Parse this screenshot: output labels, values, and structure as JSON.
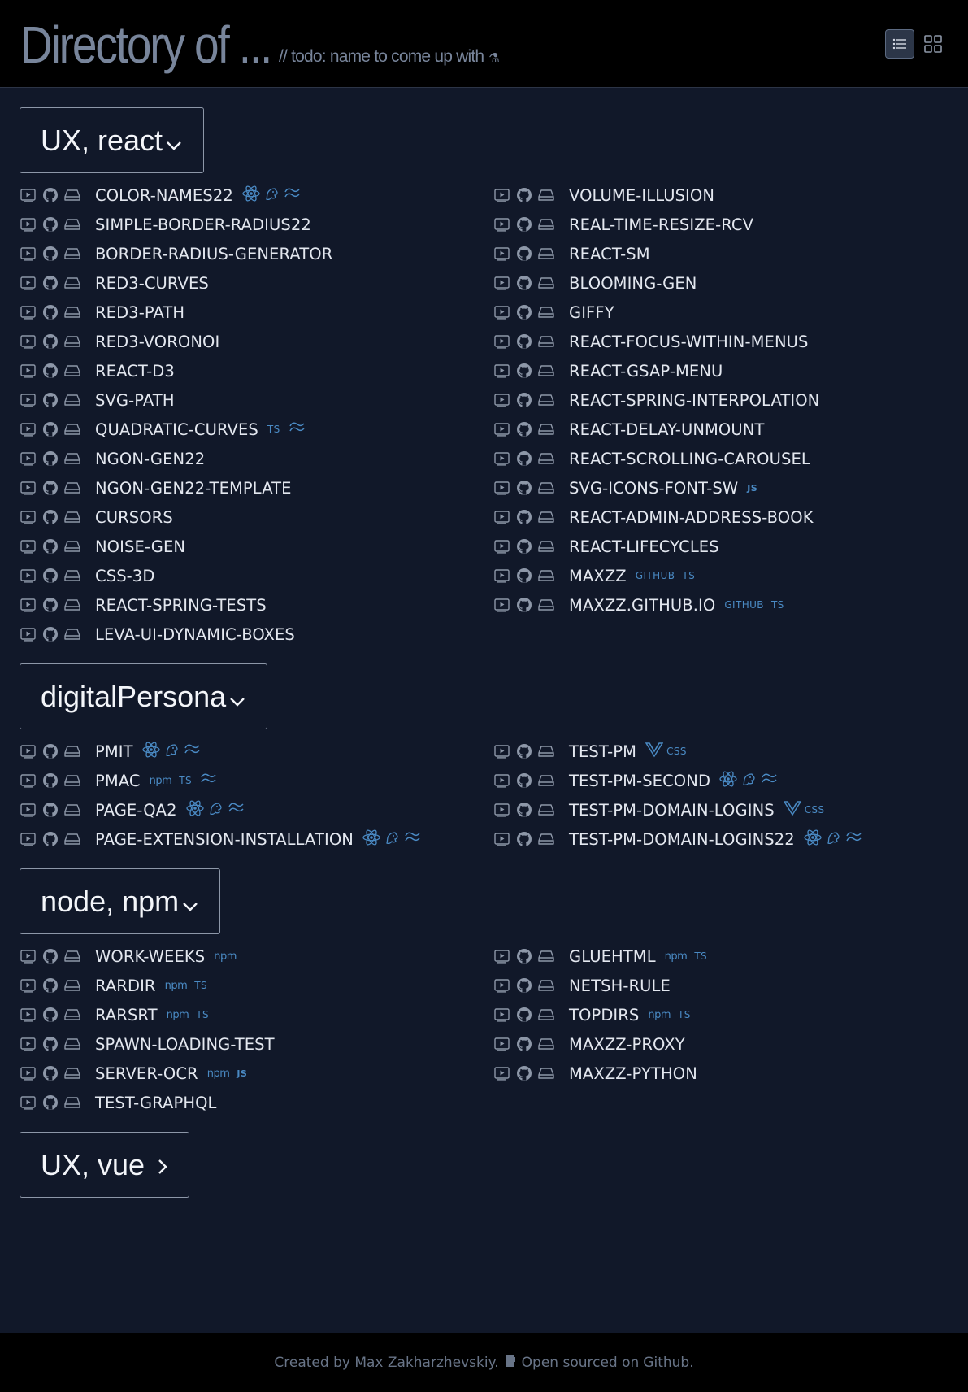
{
  "header": {
    "title": "Directory of ...",
    "subtitle": "// todo: name to come up with",
    "view_buttons": [
      "list-view",
      "grid-view"
    ]
  },
  "colors": {
    "background": "#111829",
    "header_bg": "#000000",
    "accent": "#4a8ac4",
    "title": "#78859b"
  },
  "groups": [
    {
      "title": "UX, react",
      "expanded": true,
      "items": [
        {
          "name": "COLOR-NAMES22",
          "tags": [
            "react",
            "js",
            "tw"
          ]
        },
        {
          "name": "VOLUME-ILLUSION",
          "tags": []
        },
        {
          "name": "SIMPLE-BORDER-RADIUS22",
          "tags": []
        },
        {
          "name": "REAL-TIME-RESIZE-RCV",
          "tags": []
        },
        {
          "name": "BORDER-RADIUS-GENERATOR",
          "tags": []
        },
        {
          "name": "REACT-SM",
          "tags": []
        },
        {
          "name": "RED3-CURVES",
          "tags": []
        },
        {
          "name": "BLOOMING-GEN",
          "tags": []
        },
        {
          "name": "RED3-PATH",
          "tags": []
        },
        {
          "name": "GIFFY",
          "tags": []
        },
        {
          "name": "RED3-VORONOI",
          "tags": []
        },
        {
          "name": "REACT-FOCUS-WITHIN-MENUS",
          "tags": []
        },
        {
          "name": "REACT-D3",
          "tags": []
        },
        {
          "name": "REACT-GSAP-MENU",
          "tags": []
        },
        {
          "name": "SVG-PATH",
          "tags": []
        },
        {
          "name": "REACT-SPRING-INTERPOLATION",
          "tags": []
        },
        {
          "name": "QUADRATIC-CURVES",
          "tags": [
            "TS",
            "tw"
          ]
        },
        {
          "name": "REACT-DELAY-UNMOUNT",
          "tags": []
        },
        {
          "name": "NGON-GEN22",
          "tags": []
        },
        {
          "name": "REACT-SCROLLING-CAROUSEL",
          "tags": []
        },
        {
          "name": "NGON-GEN22-TEMPLATE",
          "tags": []
        },
        {
          "name": "SVG-ICONS-FONT-SW",
          "tags": [
            "JS"
          ]
        },
        {
          "name": "CURSORS",
          "tags": []
        },
        {
          "name": "REACT-ADMIN-ADDRESS-BOOK",
          "tags": []
        },
        {
          "name": "NOISE-GEN",
          "tags": []
        },
        {
          "name": "REACT-LIFECYCLES",
          "tags": []
        },
        {
          "name": "CSS-3D",
          "tags": []
        },
        {
          "name": "MAXZZ",
          "tags": [
            "GITHUB",
            "TS"
          ]
        },
        {
          "name": "REACT-SPRING-TESTS",
          "tags": []
        },
        {
          "name": "MAXZZ.GITHUB.IO",
          "tags": [
            "GITHUB",
            "TS"
          ]
        },
        {
          "name": "LEVA-UI-DYNAMIC-BOXES",
          "tags": []
        }
      ]
    },
    {
      "title": "digitalPersona",
      "expanded": true,
      "items": [
        {
          "name": "PMIT",
          "tags": [
            "react",
            "js",
            "tw"
          ]
        },
        {
          "name": "TEST-PM",
          "tags": [
            "vue",
            "CSS"
          ]
        },
        {
          "name": "PMAC",
          "tags": [
            "npm",
            "TS",
            "tw"
          ]
        },
        {
          "name": "TEST-PM-SECOND",
          "tags": [
            "react",
            "js",
            "tw"
          ]
        },
        {
          "name": "PAGE-QA2",
          "tags": [
            "react",
            "js",
            "tw"
          ]
        },
        {
          "name": "TEST-PM-DOMAIN-LOGINS",
          "tags": [
            "vue",
            "CSS"
          ]
        },
        {
          "name": "PAGE-EXTENSION-INSTALLATION",
          "tags": [
            "react",
            "js",
            "tw"
          ]
        },
        {
          "name": "TEST-PM-DOMAIN-LOGINS22",
          "tags": [
            "react",
            "js",
            "tw"
          ]
        }
      ]
    },
    {
      "title": "node, npm",
      "expanded": true,
      "items": [
        {
          "name": "WORK-WEEKS",
          "tags": [
            "npm"
          ]
        },
        {
          "name": "GLUEHTML",
          "tags": [
            "npm",
            "TS"
          ]
        },
        {
          "name": "RARDIR",
          "tags": [
            "npm",
            "TS"
          ]
        },
        {
          "name": "NETSH-RULE",
          "tags": []
        },
        {
          "name": "RARSRT",
          "tags": [
            "npm",
            "TS"
          ]
        },
        {
          "name": "TOPDIRS",
          "tags": [
            "npm",
            "TS"
          ]
        },
        {
          "name": "SPAWN-LOADING-TEST",
          "tags": []
        },
        {
          "name": "MAXZZ-PROXY",
          "tags": []
        },
        {
          "name": "SERVER-OCR",
          "tags": [
            "npm",
            "JS"
          ]
        },
        {
          "name": "MAXZZ-PYTHON",
          "tags": []
        },
        {
          "name": "TEST-GRAPHQL",
          "tags": []
        }
      ]
    },
    {
      "title": "UX, vue",
      "expanded": false,
      "items": []
    }
  ],
  "footer": {
    "text": "Created by Max Zakharzhevskiy.",
    "open_text": "Open sourced on",
    "link": "Github",
    "dot": "."
  }
}
